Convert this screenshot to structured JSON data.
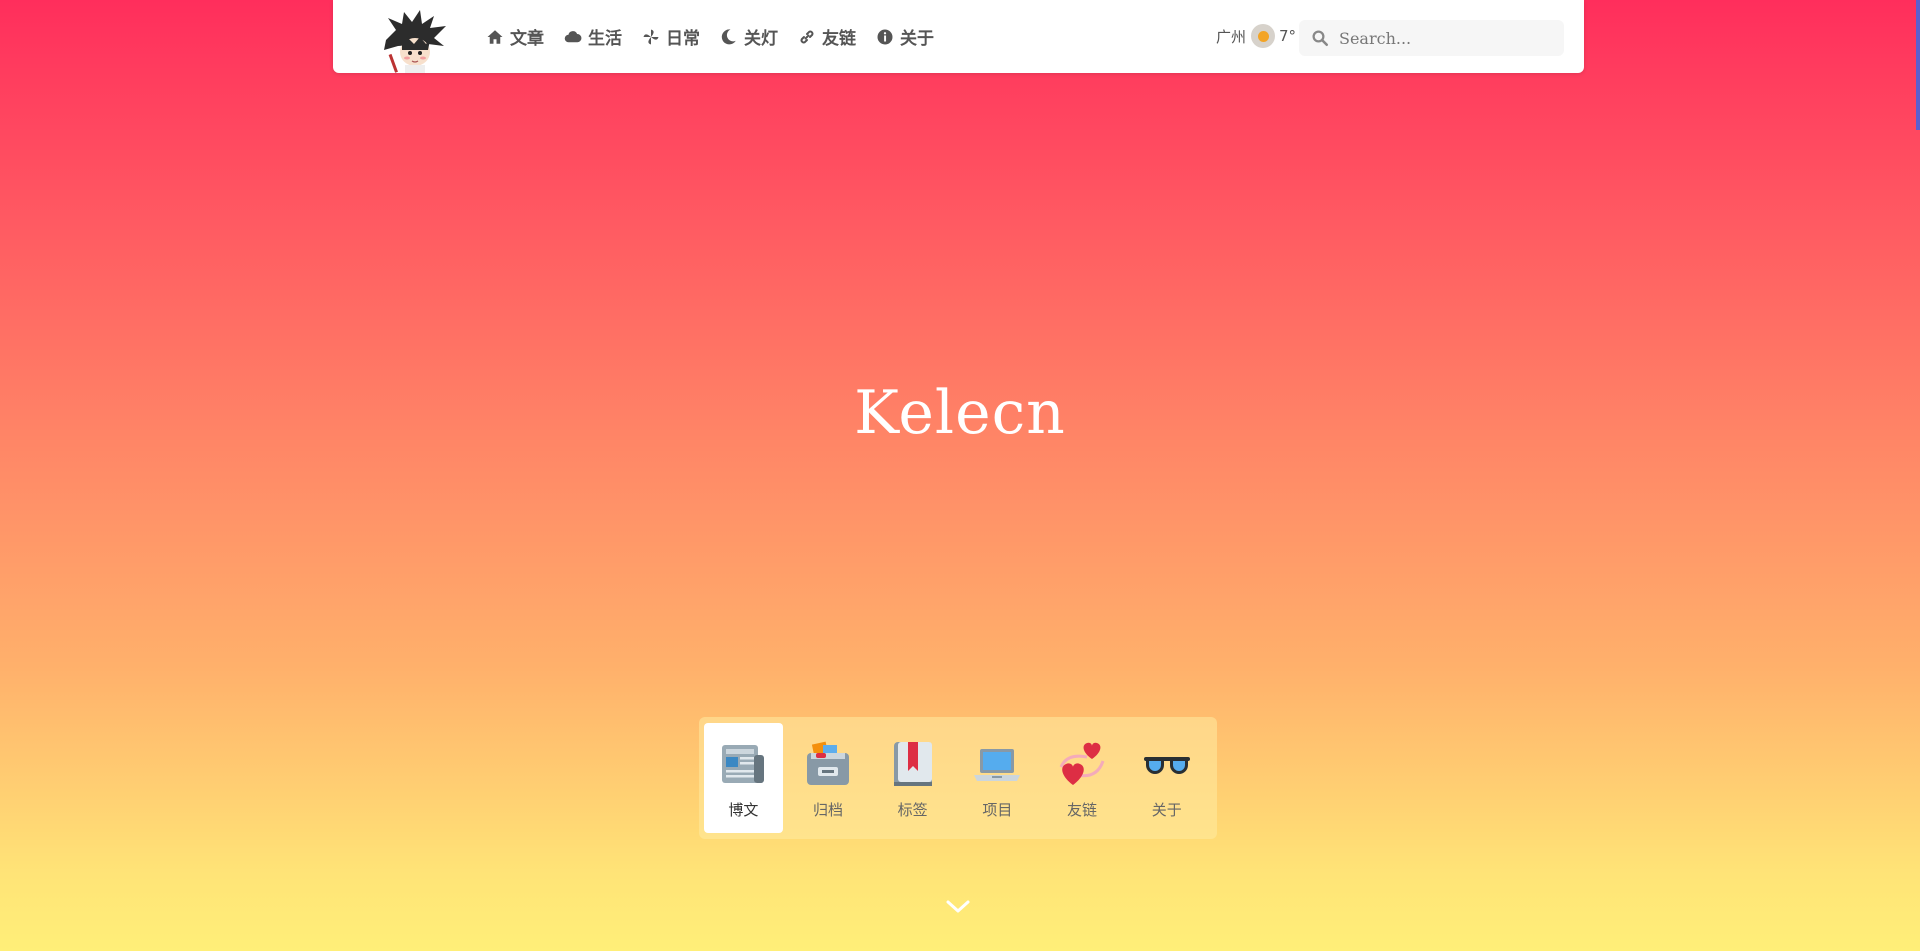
{
  "nav": {
    "menu": [
      {
        "label": "文章",
        "icon": "home-icon"
      },
      {
        "label": "生活",
        "icon": "cloud-icon"
      },
      {
        "label": "日常",
        "icon": "pinwheel-icon"
      },
      {
        "label": "关灯",
        "icon": "moon-icon"
      },
      {
        "label": "友链",
        "icon": "link-icon"
      },
      {
        "label": "关于",
        "icon": "info-icon"
      }
    ],
    "weather": {
      "city": "广州",
      "temp": "7°"
    },
    "search": {
      "placeholder": "Search..."
    }
  },
  "hero": {
    "title": "Kelecn"
  },
  "tabs": [
    {
      "label": "博文",
      "icon": "newspaper-icon",
      "active": true
    },
    {
      "label": "归档",
      "icon": "archive-box-icon",
      "active": false
    },
    {
      "label": "标签",
      "icon": "bookmark-book-icon",
      "active": false
    },
    {
      "label": "项目",
      "icon": "laptop-icon",
      "active": false
    },
    {
      "label": "友链",
      "icon": "two-hearts-icon",
      "active": false
    },
    {
      "label": "关于",
      "icon": "sunglasses-icon",
      "active": false
    }
  ],
  "colors": {
    "gradient_top": "#ff2e5c",
    "gradient_bottom": "#ffef78",
    "nav_text": "#555555"
  }
}
